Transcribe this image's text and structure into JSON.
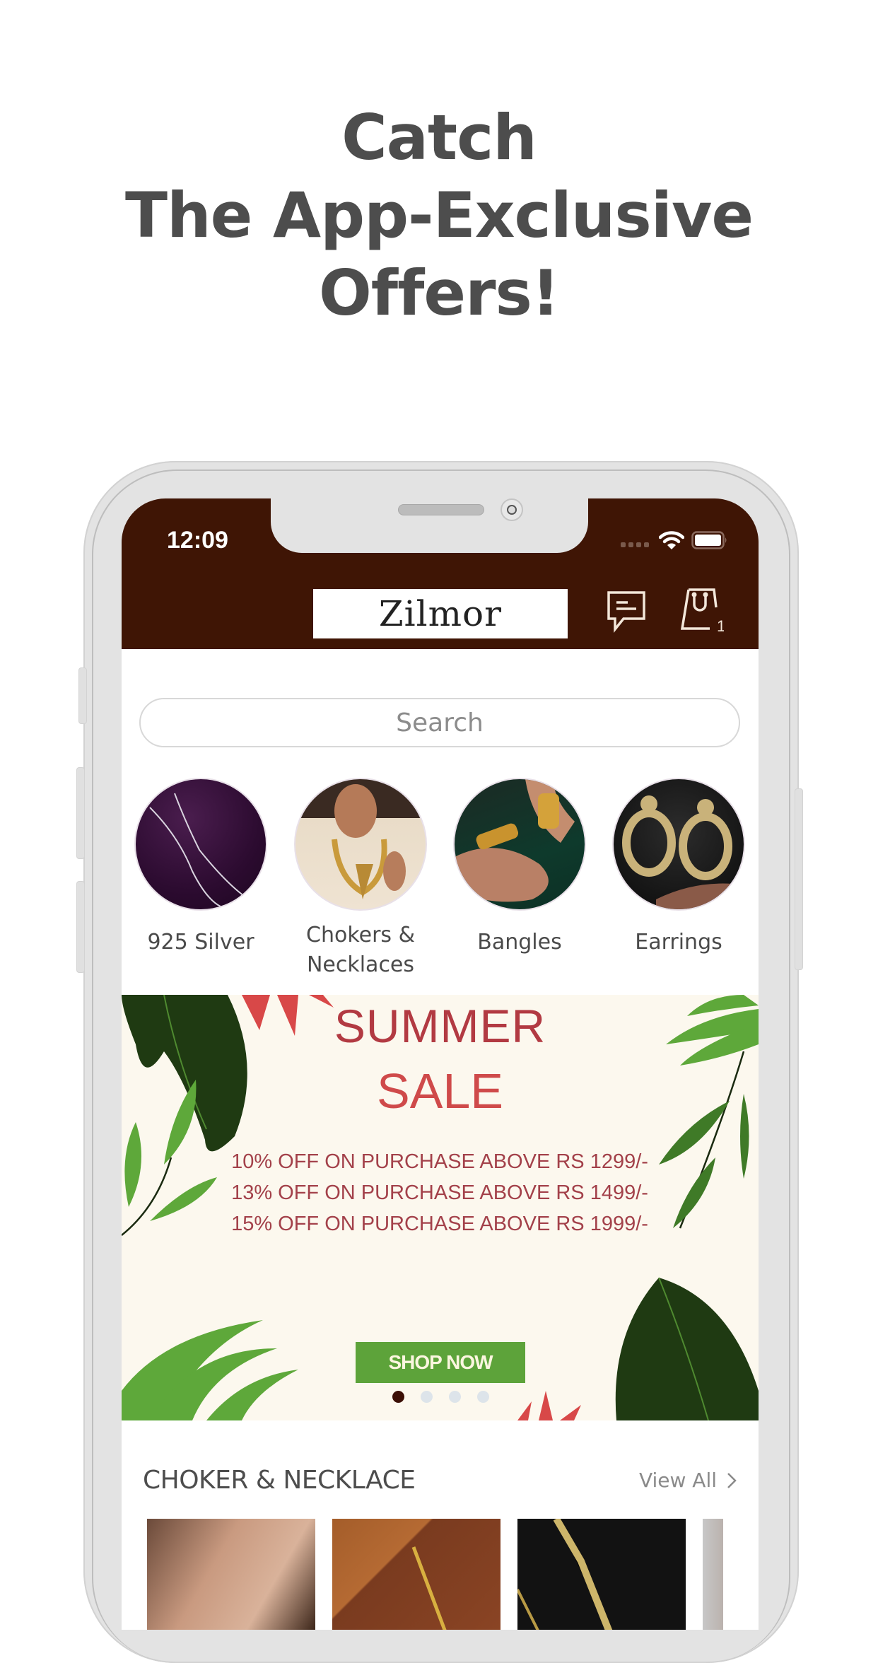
{
  "headline": {
    "lines": [
      "Catch",
      "The App-Exclusive",
      "Offers!"
    ],
    "color": "#4d4d4d"
  },
  "status_bar": {
    "time": "12:09",
    "icons": [
      "signal-dots-icon",
      "wifi-icon",
      "battery-icon"
    ]
  },
  "header": {
    "brand_color": "#3f1505",
    "logo_text": "Zilmor",
    "chat_icon": "chat-bubble-icon",
    "cart_icon": "shopping-bag-icon",
    "cart_count": "1"
  },
  "search": {
    "placeholder": "Search"
  },
  "categories": [
    {
      "label": "925 Silver",
      "image": "purple velvet with silver chains"
    },
    {
      "label": "Chokers & Necklaces",
      "image": "woman wearing gold necklace"
    },
    {
      "label": "Bangles",
      "image": "hands wearing gold bangles"
    },
    {
      "label": "Earrings",
      "image": "stone chandbali earrings"
    }
  ],
  "banner": {
    "title_line1": "SUMMER",
    "title_line2": "SALE",
    "offers": [
      "10% OFF ON PURCHASE ABOVE RS 1299/-",
      "13% OFF ON PURCHASE ABOVE RS 1499/-",
      "15% OFF ON PURCHASE ABOVE RS 1999/-"
    ],
    "cta_label": "SHOP NOW",
    "carousel": {
      "total": 4,
      "active_index": 0
    },
    "colors": {
      "background": "#fcf8ee",
      "title": "#b23a42",
      "cta": "#5da33a"
    }
  },
  "section": {
    "title": "CHOKER & NECKLACE",
    "view_all_label": "View All",
    "products": [
      {
        "image": "woman with earring and nose pin"
      },
      {
        "image": "gold chain on brown leather"
      },
      {
        "image": "gold choker on black fabric"
      },
      {
        "image": "partially visible product"
      }
    ]
  }
}
